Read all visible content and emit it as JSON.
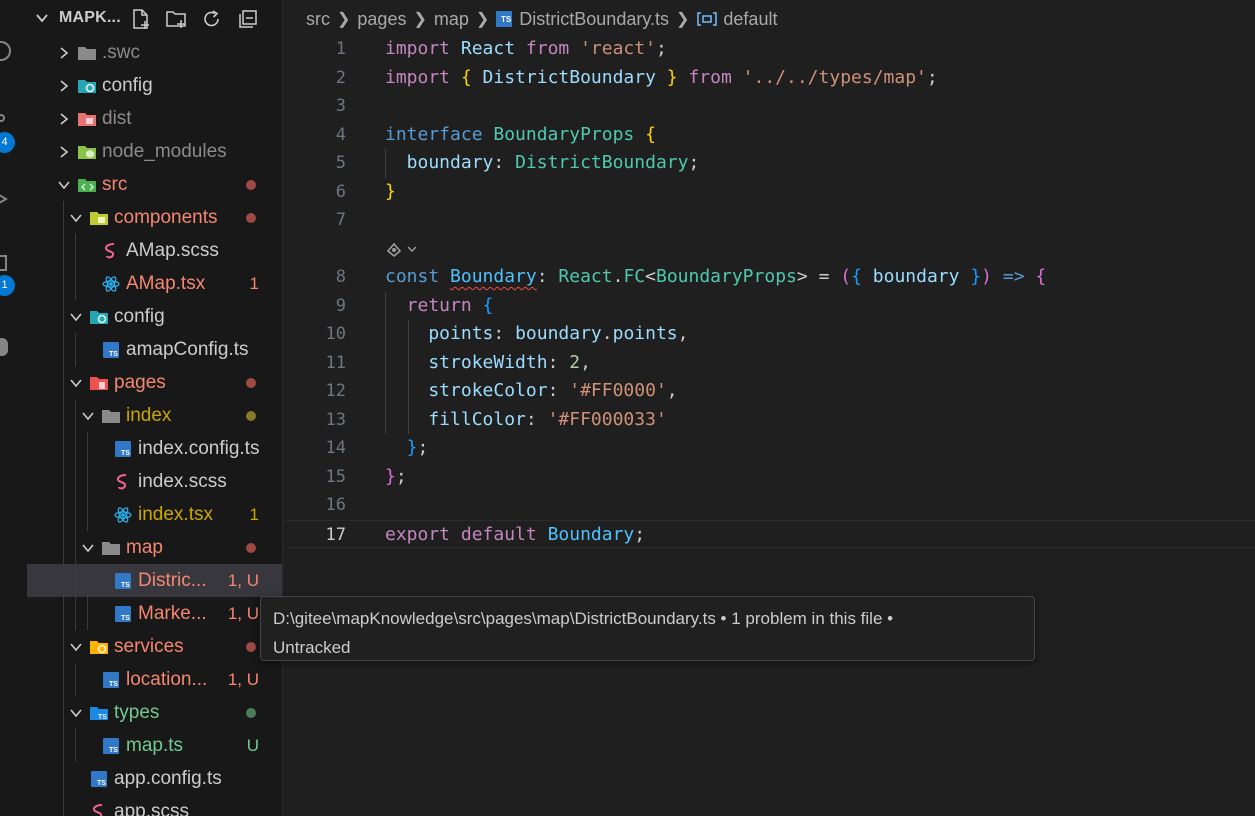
{
  "explorer": {
    "title": "MAPK...",
    "actions": [
      "new-file",
      "new-folder",
      "refresh",
      "collapse-all"
    ],
    "items": [
      {
        "label": ".swc",
        "kind": "folder",
        "icon": "folder-icon",
        "expanded": false,
        "status": "ignored"
      },
      {
        "label": "config",
        "kind": "folder",
        "icon": "config-folder-icon",
        "expanded": false
      },
      {
        "label": "dist",
        "kind": "folder",
        "icon": "dist-folder-icon",
        "expanded": false,
        "status": "ignored"
      },
      {
        "label": "node_modules",
        "kind": "folder",
        "icon": "node-modules-folder-icon",
        "expanded": false,
        "status": "ignored"
      },
      {
        "label": "src",
        "kind": "folder",
        "icon": "src-folder-icon",
        "expanded": true,
        "status": "error"
      },
      {
        "label": "components",
        "kind": "folder",
        "icon": "components-folder-icon",
        "expanded": true,
        "status": "error"
      },
      {
        "label": "AMap.scss",
        "kind": "file",
        "icon": "sass-file-icon"
      },
      {
        "label": "AMap.tsx",
        "kind": "file",
        "icon": "react-file-icon",
        "status": "error",
        "badge": "1"
      },
      {
        "label": "config",
        "kind": "folder",
        "icon": "config-folder-icon",
        "expanded": true
      },
      {
        "label": "amapConfig.ts",
        "kind": "file",
        "icon": "typescript-file-icon"
      },
      {
        "label": "pages",
        "kind": "folder",
        "icon": "pages-folder-icon",
        "expanded": true,
        "status": "error"
      },
      {
        "label": "index",
        "kind": "folder",
        "icon": "folder-icon",
        "expanded": true,
        "status": "warning"
      },
      {
        "label": "index.config.ts",
        "kind": "file",
        "icon": "typescript-file-icon"
      },
      {
        "label": "index.scss",
        "kind": "file",
        "icon": "sass-file-icon"
      },
      {
        "label": "index.tsx",
        "kind": "file",
        "icon": "react-file-icon",
        "status": "warning",
        "badge": "1"
      },
      {
        "label": "map",
        "kind": "folder",
        "icon": "folder-icon",
        "expanded": true,
        "status": "error"
      },
      {
        "label": "Distric...",
        "kind": "file",
        "icon": "typescript-file-icon",
        "status": "error",
        "badge": "1, U",
        "selected": true
      },
      {
        "label": "Marke...",
        "kind": "file",
        "icon": "typescript-file-icon",
        "status": "error",
        "badge": "1, U"
      },
      {
        "label": "services",
        "kind": "folder",
        "icon": "services-folder-icon",
        "expanded": true,
        "status": "error"
      },
      {
        "label": "location...",
        "kind": "file",
        "icon": "typescript-file-icon",
        "status": "error",
        "badge": "1, U"
      },
      {
        "label": "types",
        "kind": "folder",
        "icon": "types-folder-icon",
        "expanded": true,
        "status": "untracked"
      },
      {
        "label": "map.ts",
        "kind": "file",
        "icon": "typescript-file-icon",
        "status": "untracked",
        "badge": "U"
      },
      {
        "label": "app.config.ts",
        "kind": "file",
        "icon": "typescript-file-icon"
      },
      {
        "label": "app.scss",
        "kind": "file",
        "icon": "sass-file-icon"
      }
    ]
  },
  "activity_badges": [
    "4",
    "1"
  ],
  "breadcrumb": {
    "parts": [
      "src",
      "pages",
      "map"
    ],
    "file": "DistrictBoundary.ts",
    "symbol": "default"
  },
  "code": {
    "current_line": 17,
    "codelens_icon": "copilot-sparkle-icon",
    "lines": [
      {
        "n": "1",
        "tokens": [
          [
            "import ",
            "k2"
          ],
          [
            "React ",
            "v"
          ],
          [
            "from ",
            "k2"
          ],
          [
            "'react'",
            "s"
          ],
          [
            ";",
            "p"
          ]
        ]
      },
      {
        "n": "2",
        "tokens": [
          [
            "import ",
            "k2"
          ],
          [
            "{ ",
            "b1"
          ],
          [
            "DistrictBoundary ",
            "v"
          ],
          [
            "} ",
            "b1"
          ],
          [
            "from ",
            "k2"
          ],
          [
            "'../../types/map'",
            "s"
          ],
          [
            ";",
            "p"
          ]
        ]
      },
      {
        "n": "3",
        "tokens": []
      },
      {
        "n": "4",
        "tokens": [
          [
            "interface ",
            "k1"
          ],
          [
            "BoundaryProps ",
            "ty"
          ],
          [
            "{",
            "b1"
          ]
        ]
      },
      {
        "n": "5",
        "tokens": [
          [
            "  boundary",
            "v"
          ],
          [
            ": ",
            "p"
          ],
          [
            "DistrictBoundary",
            "ty"
          ],
          [
            ";",
            "p"
          ]
        ]
      },
      {
        "n": "6",
        "tokens": [
          [
            "}",
            "b1"
          ]
        ]
      },
      {
        "n": "7",
        "tokens": []
      },
      {
        "n": "",
        "codelens": true,
        "tokens": []
      },
      {
        "n": "8",
        "tokens": [
          [
            "const ",
            "k1"
          ],
          [
            "Boundary",
            "cn",
            "squig"
          ],
          [
            ": ",
            "p"
          ],
          [
            "React",
            "ty"
          ],
          [
            ".",
            "p"
          ],
          [
            "FC",
            "ty"
          ],
          [
            "<",
            "p"
          ],
          [
            "BoundaryProps",
            "ty"
          ],
          [
            "> ",
            "p"
          ],
          [
            "= ",
            "p"
          ],
          [
            "(",
            "b2"
          ],
          [
            "{ ",
            "b3"
          ],
          [
            "boundary ",
            "v"
          ],
          [
            "}",
            "b3"
          ],
          [
            ") ",
            "b2"
          ],
          [
            "=> ",
            "k1"
          ],
          [
            "{",
            "b2"
          ]
        ]
      },
      {
        "n": "9",
        "tokens": [
          [
            "  return ",
            "k2"
          ],
          [
            "{",
            "b3"
          ]
        ]
      },
      {
        "n": "10",
        "tokens": [
          [
            "    points",
            "v"
          ],
          [
            ": ",
            "p"
          ],
          [
            "boundary",
            "v"
          ],
          [
            ".",
            "p"
          ],
          [
            "points",
            "v"
          ],
          [
            ",",
            "p"
          ]
        ]
      },
      {
        "n": "11",
        "tokens": [
          [
            "    strokeWidth",
            "v"
          ],
          [
            ": ",
            "p"
          ],
          [
            "2",
            "n"
          ],
          [
            ",",
            "p"
          ]
        ]
      },
      {
        "n": "12",
        "tokens": [
          [
            "    strokeColor",
            "v"
          ],
          [
            ": ",
            "p"
          ],
          [
            "'#FF0000'",
            "s"
          ],
          [
            ",",
            "p"
          ]
        ]
      },
      {
        "n": "13",
        "tokens": [
          [
            "    fillColor",
            "v"
          ],
          [
            ": ",
            "p"
          ],
          [
            "'#FF000033'",
            "s"
          ]
        ]
      },
      {
        "n": "14",
        "tokens": [
          [
            "  }",
            "b3"
          ],
          [
            ";",
            "p"
          ]
        ]
      },
      {
        "n": "15",
        "tokens": [
          [
            "}",
            "b2"
          ],
          [
            ";",
            "p"
          ]
        ]
      },
      {
        "n": "16",
        "tokens": []
      },
      {
        "n": "17",
        "tokens": [
          [
            "export ",
            "k2"
          ],
          [
            "default ",
            "k2"
          ],
          [
            "Boundary",
            "cn"
          ],
          [
            ";",
            "p"
          ]
        ]
      }
    ]
  },
  "tooltip": {
    "line1": "D:\\gitee\\mapKnowledge\\src\\pages\\map\\DistrictBoundary.ts • 1 problem in this file •",
    "line2": "Untracked"
  },
  "colors": {
    "error": "#f48771",
    "warning": "#cca700",
    "untracked": "#73c991",
    "error_dot": "#9e4a42",
    "warning_dot": "#8a7a2a",
    "untracked_dot": "#4a7d5a"
  }
}
